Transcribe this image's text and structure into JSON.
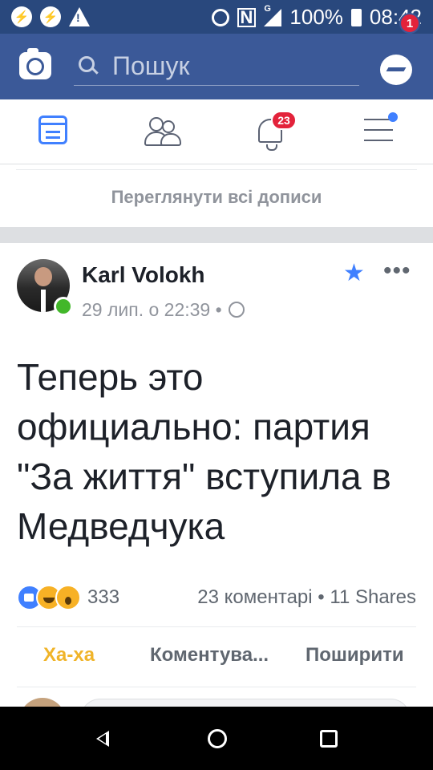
{
  "status_bar": {
    "icons": [
      "messenger-icon",
      "messenger-icon",
      "warning-icon",
      "location-icon",
      "nfc-icon",
      "signal-icon",
      "battery-icon"
    ],
    "nfc": "N",
    "signal_type": "G",
    "battery": "100%",
    "time": "08:42"
  },
  "top_bar": {
    "search_placeholder": "Пошук",
    "messenger_badge": "1",
    "brand_color": "#3b5998"
  },
  "nav": {
    "notifications_badge": "23",
    "active_color": "#4080ff"
  },
  "feed": {
    "see_all_posts": "Переглянути всі дописи"
  },
  "post": {
    "author": "Karl Volokh",
    "timestamp": "29 лип. о 22:39",
    "separator": "•",
    "text": "Теперь это официально: партия \"За життя\" вступила в Медведчука",
    "reaction_count": "333",
    "comments": "23 коментарі",
    "shares": "11 Shares",
    "actions": {
      "haha": "Ха-ха",
      "comment": "Коментува...",
      "share": "Поширити"
    }
  }
}
